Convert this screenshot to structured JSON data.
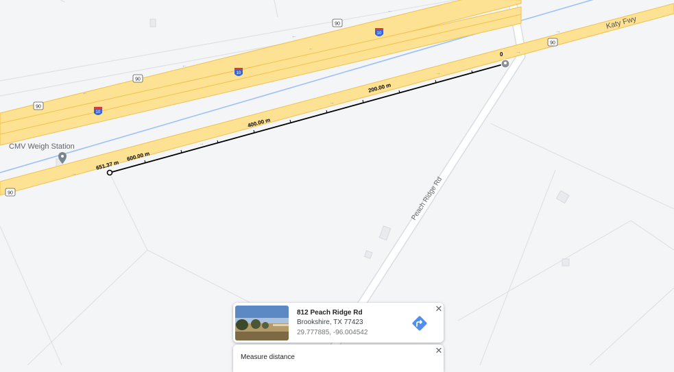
{
  "map": {
    "road_labels": {
      "katy_fwy": "Katy Fwy",
      "peach_ridge_rd": "Peach Ridge Rd"
    },
    "shields": {
      "us90": "90",
      "i10": "10"
    },
    "poi": {
      "weigh_station": "CMV Weigh Station"
    },
    "measurement_labels": {
      "start": "0",
      "m200": "200.00 m",
      "m400": "400.00 m",
      "m600": "600.00 m",
      "total": "651.37 m"
    },
    "colors": {
      "highway_fill": "#fde293",
      "highway_edge": "#f2c14a",
      "water_line": "#9cc0f9",
      "measure_line": "#000000",
      "background": "#f4f5f7"
    }
  },
  "place_card": {
    "name": "812 Peach Ridge Rd",
    "city": "Brookshire, TX 77423",
    "coords": "29.777885, -96.004542",
    "close_icon": "close-icon",
    "directions_icon": "directions-icon"
  },
  "measure_card": {
    "title": "Measure distance",
    "close_icon": "close-icon"
  }
}
